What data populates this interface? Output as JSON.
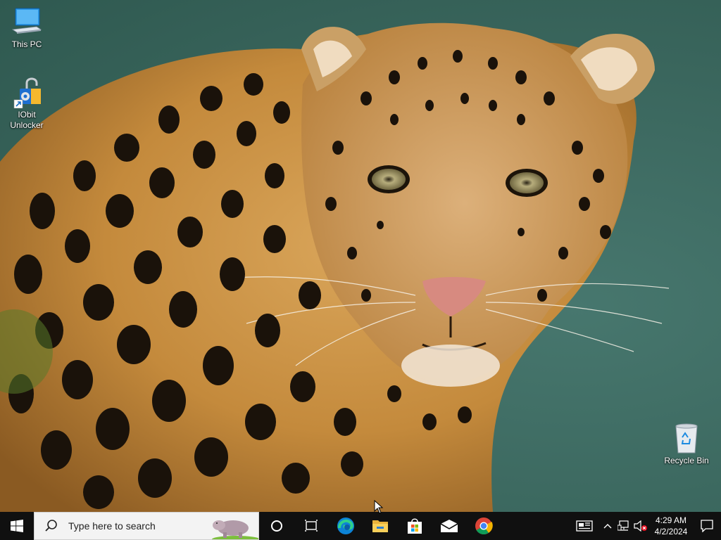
{
  "desktop": {
    "icons": [
      {
        "label": "This PC",
        "icon": "this-pc-icon"
      },
      {
        "label": "IObit Unlocker",
        "label_line1": "IObit",
        "label_line2": "Unlocker",
        "icon": "iobit-unlocker-icon"
      },
      {
        "label": "Recycle Bin",
        "icon": "recycle-bin-icon"
      }
    ],
    "wallpaper": "leopard"
  },
  "taskbar": {
    "search_placeholder": "Type here to search",
    "pinned": [
      {
        "name": "cortana",
        "icon": "cortana-circle-icon"
      },
      {
        "name": "task-view",
        "icon": "task-view-icon"
      },
      {
        "name": "edge",
        "icon": "edge-icon"
      },
      {
        "name": "file-explorer",
        "icon": "folder-icon"
      },
      {
        "name": "microsoft-store",
        "icon": "store-bag-icon"
      },
      {
        "name": "mail",
        "icon": "mail-icon"
      },
      {
        "name": "chrome",
        "icon": "chrome-icon"
      }
    ],
    "tray": {
      "news_icon": "news-icon",
      "time": "4:29 AM",
      "date": "4/2/2024"
    },
    "colors": {
      "taskbar_bg": "#101010",
      "windows_blue": "#0078d7",
      "edge_blue": "#0c83d6",
      "chrome_red": "#db4437",
      "chrome_yellow": "#f4b400",
      "chrome_green": "#0f9d58"
    }
  }
}
